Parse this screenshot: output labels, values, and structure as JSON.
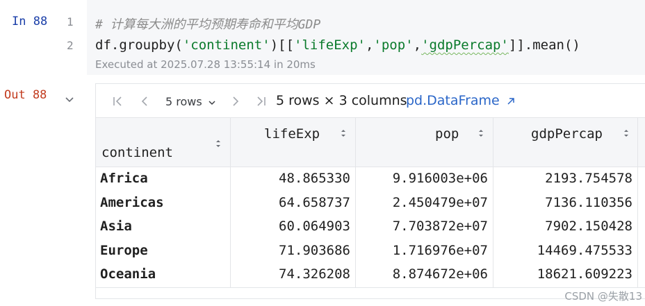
{
  "input_cell": {
    "prompt": "In 88",
    "line_numbers": [
      "1",
      "2"
    ],
    "comment": "# 计算每大洲的平均预期寿命和平均GDP",
    "code": {
      "p1": "df.groupby(",
      "s1": "'continent'",
      "p2": ")[[",
      "s2": "'lifeExp'",
      "p3": ",",
      "s3": "'pop'",
      "p4": ",",
      "s4": "'gdpPercap'",
      "p5": "]].mean()"
    },
    "executed": "Executed at 2025.07.28 13:55:14 in 20ms"
  },
  "output_cell": {
    "prompt": "Out 88",
    "toolbar": {
      "rows_label": "5 rows",
      "summary": "5 rows × 3 columns",
      "type_link": "pd.DataFrame"
    },
    "table": {
      "index_name": "continent",
      "columns": [
        "lifeExp",
        "pop",
        "gdpPercap"
      ],
      "rows": [
        {
          "index": "Africa",
          "values": [
            "48.865330",
            "9.916003e+06",
            "2193.754578"
          ]
        },
        {
          "index": "Americas",
          "values": [
            "64.658737",
            "2.450479e+07",
            "7136.110356"
          ]
        },
        {
          "index": "Asia",
          "values": [
            "60.064903",
            "7.703872e+07",
            "7902.150428"
          ]
        },
        {
          "index": "Europe",
          "values": [
            "71.903686",
            "1.716976e+07",
            "14469.475533"
          ]
        },
        {
          "index": "Oceania",
          "values": [
            "74.326208",
            "8.874672e+06",
            "18621.609223"
          ]
        }
      ]
    }
  },
  "watermark": "CSDN @失散13",
  "colors": {
    "prompt_in": "#1a3ea8",
    "prompt_out": "#c23b1e",
    "string": "#0a7a2b",
    "link": "#2a66c8"
  }
}
